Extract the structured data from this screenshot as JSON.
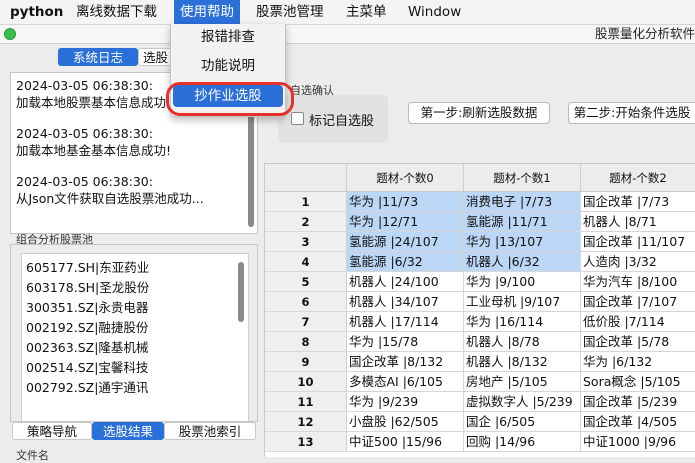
{
  "menubar": {
    "items": [
      "python",
      "离线数据下载",
      "使用帮助",
      "股票池管理",
      "主菜单",
      "Window"
    ],
    "active": "使用帮助"
  },
  "window": {
    "title": "股票量化分析软件"
  },
  "dropdown": {
    "items": [
      "报错排查",
      "功能说明",
      "抄作业选股"
    ],
    "highlighted": "抄作业选股"
  },
  "left_tabs": [
    "系统日志",
    "选股"
  ],
  "log": [
    {
      "time": "2024-03-05 06:38:30:",
      "msg": "加载本地股票基本信息成功"
    },
    {
      "time": "2024-03-05 06:38:30:",
      "msg": "加载本地基金基本信息成功!"
    },
    {
      "time": "2024-03-05 06:38:30:",
      "msg": "从Json文件获取自选股票池成功..."
    }
  ],
  "group_label": "组合分析股票池",
  "stocks": [
    "605177.SH|东亚药业",
    "603178.SH|圣龙股份",
    "300351.SZ|永贵电器",
    "002192.SZ|融捷股份",
    "002363.SZ|隆基机械",
    "002514.SZ|宝馨科技",
    "002792.SZ|通宇通讯"
  ],
  "bottom_tabs": [
    "策略导航",
    "选股结果",
    "股票池索引"
  ],
  "bottom_selected": "选股结果",
  "file_label": "文件名",
  "confirm": {
    "label": "自选确认",
    "checkbox_label": "标记自选股",
    "checked": false
  },
  "buttons": {
    "step1": "第一步:刷新选股数据",
    "step2": "第二步:开始条件选股"
  },
  "table": {
    "headers": [
      "题材-个数0",
      "题材-个数1",
      "题材-个数2"
    ],
    "rows": [
      {
        "n": "1",
        "cells": [
          "华为 |11/73",
          "消费电子 |7/73",
          "国企改革 |7/73"
        ]
      },
      {
        "n": "2",
        "cells": [
          "华为 |12/71",
          "氢能源 |11/71",
          "机器人 |8/71"
        ]
      },
      {
        "n": "3",
        "cells": [
          "氢能源 |24/107",
          "华为 |13/107",
          "国企改革 |11/107"
        ]
      },
      {
        "n": "4",
        "cells": [
          "氢能源 |6/32",
          "机器人 |6/32",
          "人造肉 |3/32"
        ]
      },
      {
        "n": "5",
        "cells": [
          "机器人 |24/100",
          "华为 |9/100",
          "华为汽车 |8/100"
        ]
      },
      {
        "n": "6",
        "cells": [
          "机器人 |34/107",
          "工业母机 |9/107",
          "国企改革 |7/107"
        ]
      },
      {
        "n": "7",
        "cells": [
          "机器人 |17/114",
          "华为 |16/114",
          "低价股 |7/114"
        ]
      },
      {
        "n": "8",
        "cells": [
          "华为 |15/78",
          "机器人 |8/78",
          "国企改革 |5/78"
        ]
      },
      {
        "n": "9",
        "cells": [
          "国企改革 |8/132",
          "机器人 |8/132",
          "华为 |6/132"
        ]
      },
      {
        "n": "10",
        "cells": [
          "多模态AI |6/105",
          "房地产 |5/105",
          "Sora概念 |5/105"
        ]
      },
      {
        "n": "11",
        "cells": [
          "华为 |9/239",
          "虚拟数字人 |5/239",
          "国企改革 |5/239"
        ]
      },
      {
        "n": "12",
        "cells": [
          "小盘股 |62/505",
          "国企 |6/505",
          "国企改革 |4/505"
        ]
      },
      {
        "n": "13",
        "cells": [
          "中证500 |15/96",
          "回购 |14/96",
          "中证1000 |9/96"
        ]
      }
    ],
    "selected_rows": 4,
    "selected_cols": 2
  },
  "colors": {
    "accent": "#2b6fd8",
    "selection": "#bcd6f5",
    "annotation_ring": "#e8302b"
  }
}
